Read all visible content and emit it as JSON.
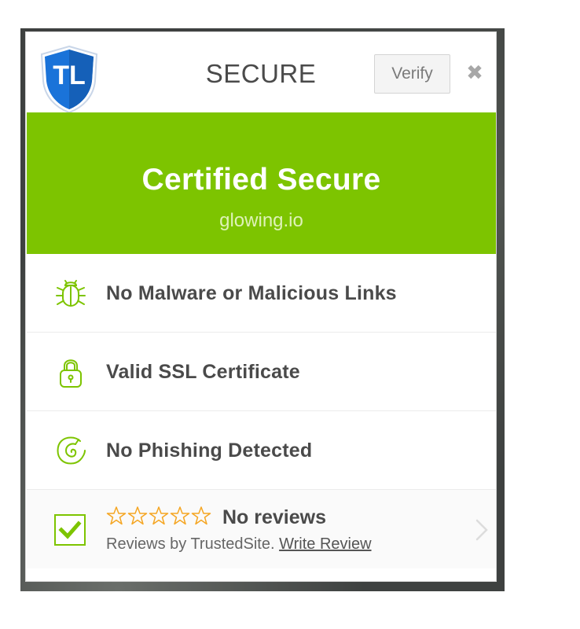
{
  "header": {
    "logo_text": "TL",
    "title": "SECURE",
    "verify_label": "Verify",
    "close_glyph": "✖"
  },
  "banner": {
    "title": "Certified Secure",
    "domain": "glowing.io"
  },
  "checks": [
    {
      "label": "No Malware or Malicious Links",
      "icon": "bug-icon"
    },
    {
      "label": "Valid SSL Certificate",
      "icon": "lock-icon"
    },
    {
      "label": "No Phishing Detected",
      "icon": "phishing-hook-icon"
    }
  ],
  "reviews": {
    "rating_stars": 0,
    "stars_total": 5,
    "label": "No reviews",
    "by_text": "Reviews by TrustedSite.",
    "write_review_label": "Write Review"
  },
  "colors": {
    "banner_green": "#7dc400",
    "icon_green": "#7dc400",
    "star_orange": "#f5a623",
    "logo_blue": "#1a73d9"
  }
}
